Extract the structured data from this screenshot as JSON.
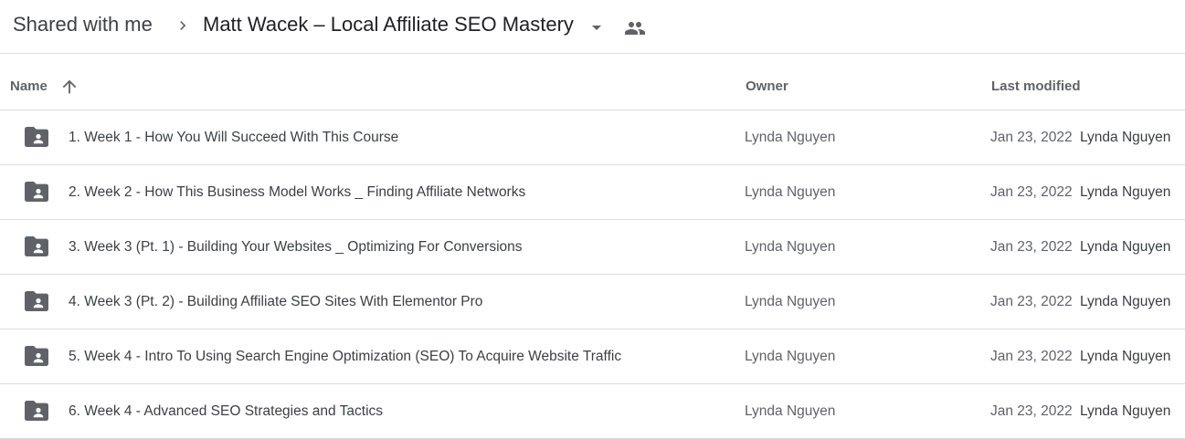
{
  "breadcrumb": {
    "root": "Shared with me",
    "current": "Matt Wacek – Local Affiliate SEO Mastery"
  },
  "icons": {
    "separator": "chevron-right-icon",
    "dropdown": "caret-down-icon",
    "shared": "people-icon",
    "sort": "arrow-up-icon",
    "folder": "shared-folder-icon"
  },
  "columns": {
    "name": "Name",
    "owner": "Owner",
    "last_modified": "Last modified"
  },
  "colors": {
    "icon": "#5f6368",
    "divider": "#dadce0",
    "text_primary": "#3c4043",
    "text_secondary": "#5f6368"
  },
  "files": [
    {
      "name": "1. Week 1 - How You Will Succeed With This Course",
      "owner": "Lynda Nguyen",
      "date": "Jan 23, 2022",
      "modifier": "Lynda Nguyen"
    },
    {
      "name": "2. Week 2 - How This Business Model Works _ Finding Affiliate Networks",
      "owner": "Lynda Nguyen",
      "date": "Jan 23, 2022",
      "modifier": "Lynda Nguyen"
    },
    {
      "name": "3. Week 3 (Pt. 1) - Building Your Websites _ Optimizing For Conversions",
      "owner": "Lynda Nguyen",
      "date": "Jan 23, 2022",
      "modifier": "Lynda Nguyen"
    },
    {
      "name": "4. Week 3 (Pt. 2) - Building Affiliate SEO Sites With Elementor Pro",
      "owner": "Lynda Nguyen",
      "date": "Jan 23, 2022",
      "modifier": "Lynda Nguyen"
    },
    {
      "name": "5. Week 4 - Intro To Using Search Engine Optimization (SEO) To Acquire Website Traffic",
      "owner": "Lynda Nguyen",
      "date": "Jan 23, 2022",
      "modifier": "Lynda Nguyen"
    },
    {
      "name": "6. Week 4 - Advanced SEO Strategies and Tactics",
      "owner": "Lynda Nguyen",
      "date": "Jan 23, 2022",
      "modifier": "Lynda Nguyen"
    }
  ]
}
